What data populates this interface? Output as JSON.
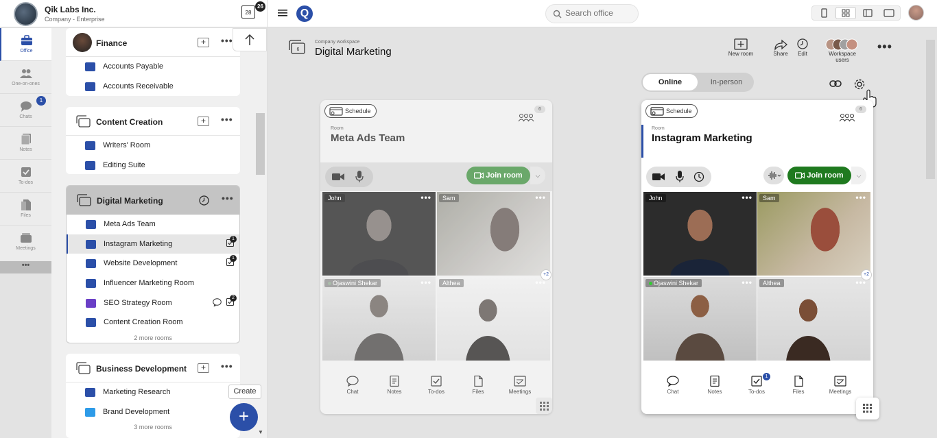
{
  "org": {
    "name": "Qik Labs Inc.",
    "plan": "Company - Enterprise"
  },
  "calendar": {
    "day": "28",
    "badge": "26"
  },
  "search": {
    "placeholder": "Search office"
  },
  "rail": [
    {
      "label": "Office",
      "icon": "briefcase-icon"
    },
    {
      "label": "One-on-ones",
      "icon": "users-icon"
    },
    {
      "label": "Chats",
      "icon": "chat-icon",
      "badge": "1"
    },
    {
      "label": "Notes",
      "icon": "notes-icon"
    },
    {
      "label": "To-dos",
      "icon": "todo-icon"
    },
    {
      "label": "Files",
      "icon": "files-icon"
    },
    {
      "label": "Meetings",
      "icon": "meetings-icon"
    }
  ],
  "rail_more": "•••",
  "sidebar": {
    "finance": {
      "title": "Finance",
      "rooms": [
        "Accounts Payable",
        "Accounts Receivable"
      ]
    },
    "content": {
      "title": "Content Creation",
      "rooms": [
        "Writers' Room",
        "Editing Suite"
      ]
    },
    "dm": {
      "title": "Digital Marketing",
      "rooms": [
        "Meta Ads Team",
        "Instagram Marketing",
        "Website Development",
        "Influencer Marketing Room",
        "SEO Strategy Room",
        "Content Creation Room"
      ],
      "todo_badges": {
        "instagram": "1",
        "website": "1",
        "seo": "2"
      },
      "more": "2 more rooms"
    },
    "bizdev": {
      "title": "Business Development",
      "rooms": [
        "Marketing Research",
        "Brand Development"
      ],
      "more": "3 more rooms"
    }
  },
  "create_tooltip": "Create",
  "workspace": {
    "subtitle": "Company workspace",
    "title": "Digital Marketing",
    "count": "6"
  },
  "toolbar": {
    "new_room": "New room",
    "share": "Share",
    "edit": "Edit",
    "workspace_users": "Workspace users"
  },
  "mode": {
    "online": "Online",
    "inperson": "In-person"
  },
  "rooms": [
    {
      "schedule": "Schedule",
      "count": "6",
      "label": "Room",
      "name": "Meta Ads Team",
      "join": "Join room",
      "join_color": "#6aa86a"
    },
    {
      "schedule": "Schedule",
      "count": "6",
      "label": "Room",
      "name": "Instagram Marketing",
      "join": "Join room",
      "join_color": "#1f7a1f"
    }
  ],
  "participants": [
    "John",
    "Sam",
    "Ojaswini Shekar",
    "Althea"
  ],
  "extra_participants": "+2",
  "footer": {
    "chat": "Chat",
    "notes": "Notes",
    "todos": "To-dos",
    "files": "Files",
    "meetings": "Meetings",
    "todos_badge": "1"
  },
  "colors": {
    "accent": "#2b4fa8",
    "seo_room": "#6a3fc6",
    "brand_room": "#2d9be8"
  }
}
